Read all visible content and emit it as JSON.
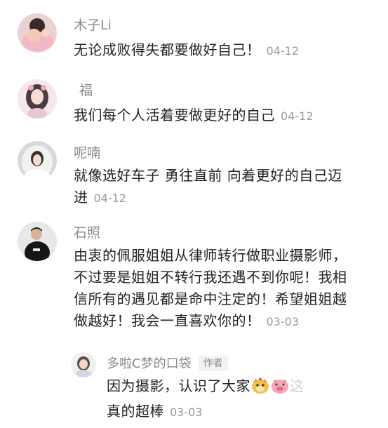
{
  "comments": [
    {
      "username": "木子Li",
      "text": "无论成败得失都要做好自己！",
      "date": "04-12",
      "avatar": "avatar-child-pink"
    },
    {
      "username": "福",
      "text": "我们每个人活着要做更好的自己",
      "date": "04-12",
      "avatar": "avatar-girl-illustration"
    },
    {
      "username": "呢喃",
      "text_line1": "就像选好车子 勇往直前 向着更好的自己迈",
      "text_line2": "进",
      "date": "04-12",
      "avatar": "avatar-bride"
    },
    {
      "username": "石照",
      "text_line1": "由衷的佩服姐姐从律师转行做职业摄影师，",
      "text_line2": "不过要是姐姐不转行我还遇不到你呢！我相",
      "text_line3": "信所有的遇见都是命中注定的！希望姐姐越",
      "text_line4": "做越好！我会一直喜欢你的！",
      "date": "03-03",
      "avatar": "avatar-man-black"
    }
  ],
  "reply": {
    "username": "多啦C梦的口袋",
    "badge": "作者",
    "text_line1": "因为摄影，认识了大家",
    "text_tail": "这",
    "text_line2": "真的超棒",
    "date": "03-03",
    "avatar": "avatar-woman-light",
    "emojis": [
      "dog-face-emoji",
      "pig-face-emoji"
    ]
  },
  "colors": {
    "username": "#8a8a8a",
    "text": "#222222",
    "date": "#9a9a9a",
    "badge_bg": "#f2f2f2"
  }
}
